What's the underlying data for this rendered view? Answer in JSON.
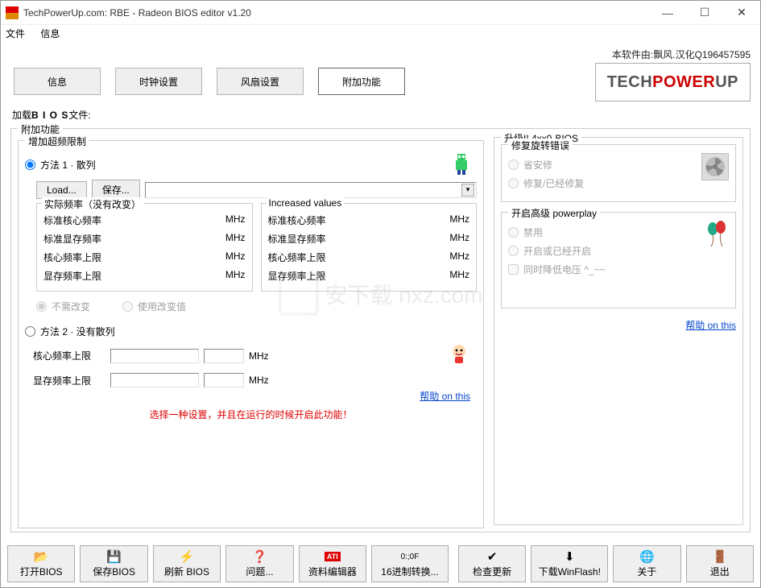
{
  "window": {
    "title": "TechPowerUp.com: RBE - Radeon BIOS editor v1.20"
  },
  "menu": {
    "file": "文件",
    "info": "信息"
  },
  "credit": "本软件由:飘风.汉化Q196457595",
  "tabs": {
    "info": "信息",
    "clock": "时钟设置",
    "fan": "风扇设置",
    "extra": "附加功能"
  },
  "logo": {
    "tech": "TECH",
    "power": "POWER",
    "up": "UP"
  },
  "biosfile": {
    "prefix": "加载",
    "bios": "B I O S",
    "suffix": "文件:"
  },
  "group_extra": "附加功能",
  "group_oc": "增加超频限制",
  "method1": "方法 1 · 散列",
  "btn_load": "Load...",
  "btn_save": "保存...",
  "actual_title": "实际频率（没有改变）",
  "inc_title": "Increased values",
  "rows": {
    "core_std": "标准核心频率",
    "mem_std": "标准显存频率",
    "core_lim": "核心频率上限",
    "mem_lim": "显存频率上限"
  },
  "mhz": "MHz",
  "rb_no_change": "不需改变",
  "rb_use_changed": "使用改变值",
  "method2": "方法 2 · 没有散列",
  "m2_core": "核心频率上限",
  "m2_mem": "显存频率上限",
  "help_link": "帮助 on this",
  "red_note": "选择一种设置，并且在运行的时候开启此功能！",
  "right_title": "升级!! 4xx0-BIOS",
  "spin_title": "修复旋转错误",
  "spin_r1": "省安修",
  "spin_r2": "修复/已经修复",
  "pp_title": "开启高级 powerplay",
  "pp_r1": "禁用",
  "pp_r2": "开启或已经开启",
  "pp_chk": "同时降低电压 ^_~~",
  "bottom": {
    "open": "打开BIOS",
    "save": "保存BIOS",
    "flash": "刷新 BIOS",
    "issue": "问题...",
    "dataedit": "资料编辑器",
    "hex": "16进制转换...",
    "check": "检查更新",
    "winflash": "下载WinFlash!",
    "about": "关于",
    "exit": "退出"
  }
}
